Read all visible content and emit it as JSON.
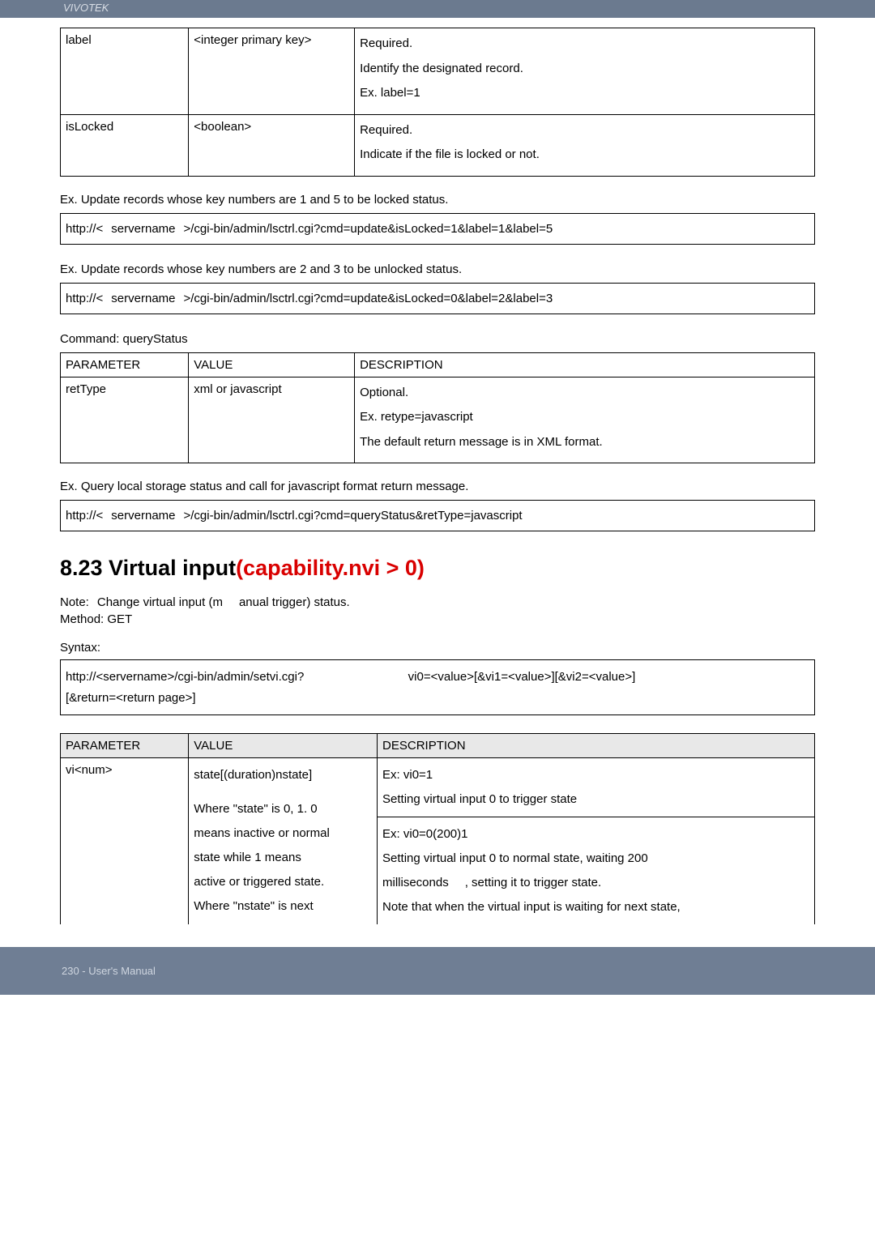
{
  "brand": "VIVOTEK",
  "table1": {
    "row1": {
      "param": "label",
      "value": "<integer primary key>",
      "d1": "Required.",
      "d2": "Identify the designated record.",
      "d3": "Ex. label=1"
    },
    "row2": {
      "param": "isLocked",
      "value": "<boolean>",
      "d1": "Required.",
      "d2": "Indicate if the file is locked or not."
    }
  },
  "ex1_label": "Ex. Update records whose key numbers are 1 and 5 to be locked status.",
  "ex1_cmd_a": "http://<",
  "ex1_cmd_b": "servername",
  "ex1_cmd_c": ">/cgi-bin/admin/lsctrl.cgi?cmd=update&isLocked=1&label=1&label=5",
  "ex2_label": "Ex. Update records whose key numbers are 2 and 3 to be unlocked status.",
  "ex2_cmd_a": "http://<",
  "ex2_cmd_b": "servername",
  "ex2_cmd_c": ">/cgi-bin/admin/lsctrl.cgi?cmd=update&isLocked=0&label=2&label=3",
  "cmd_label": "Command: queryStatus",
  "table2": {
    "head": {
      "p": "PARAMETER",
      "v": "VALUE",
      "d": "DESCRIPTION"
    },
    "row1": {
      "param": "retType",
      "value": "xml or javascript",
      "d1": "Optional.",
      "d2": "Ex. retype=javascript",
      "d3": "The default return message is in XML format."
    }
  },
  "ex3_label": "Ex. Query local storage status and call for javascript format return message.",
  "ex3_cmd_a": "http://<",
  "ex3_cmd_b": "servername",
  "ex3_cmd_c": ">/cgi-bin/admin/lsctrl.cgi?cmd=queryStatus&retType=javascript",
  "section_title_a": "8.23 Virtual input",
  "section_title_b": "(capability.nvi > 0)",
  "note_a": "Note:",
  "note_b": "Change virtual input (m",
  "note_c": "anual trigger) status.",
  "method": "Method: GET",
  "syntax_label": "Syntax:",
  "syntax_line1_a": "http://<servername>/cgi-bin/admin/setvi.cgi?",
  "syntax_line1_b": "vi0=<value>[&vi1=<value>][&vi2=<value>]",
  "syntax_line2": "[&return=<return page>]",
  "table3": {
    "head": {
      "p": "PARAMETER",
      "v": "VALUE",
      "d": "DESCRIPTION"
    },
    "row1": {
      "param": "vi<num>",
      "v1": "state[(duration)nstate]",
      "v2": "Where \"state\" is 0, 1.  0",
      "v3": "means inactive or normal",
      "v4": "state while 1  means",
      "v5": "active or triggered state.",
      "v6": "Where \"nstate\" is next",
      "d1": "Ex: vi0=1",
      "d2": "Setting virtual input 0 to trigger state",
      "d3": "Ex: vi0=0(200)1",
      "d4": "Setting virtual input 0 to normal state, waiting 200",
      "d5a": "milliseconds",
      "d5b": ", setting it to trigger state.",
      "d6": "Note that when the virtual input is waiting for next state,"
    }
  },
  "footer": "230 - User's Manual"
}
